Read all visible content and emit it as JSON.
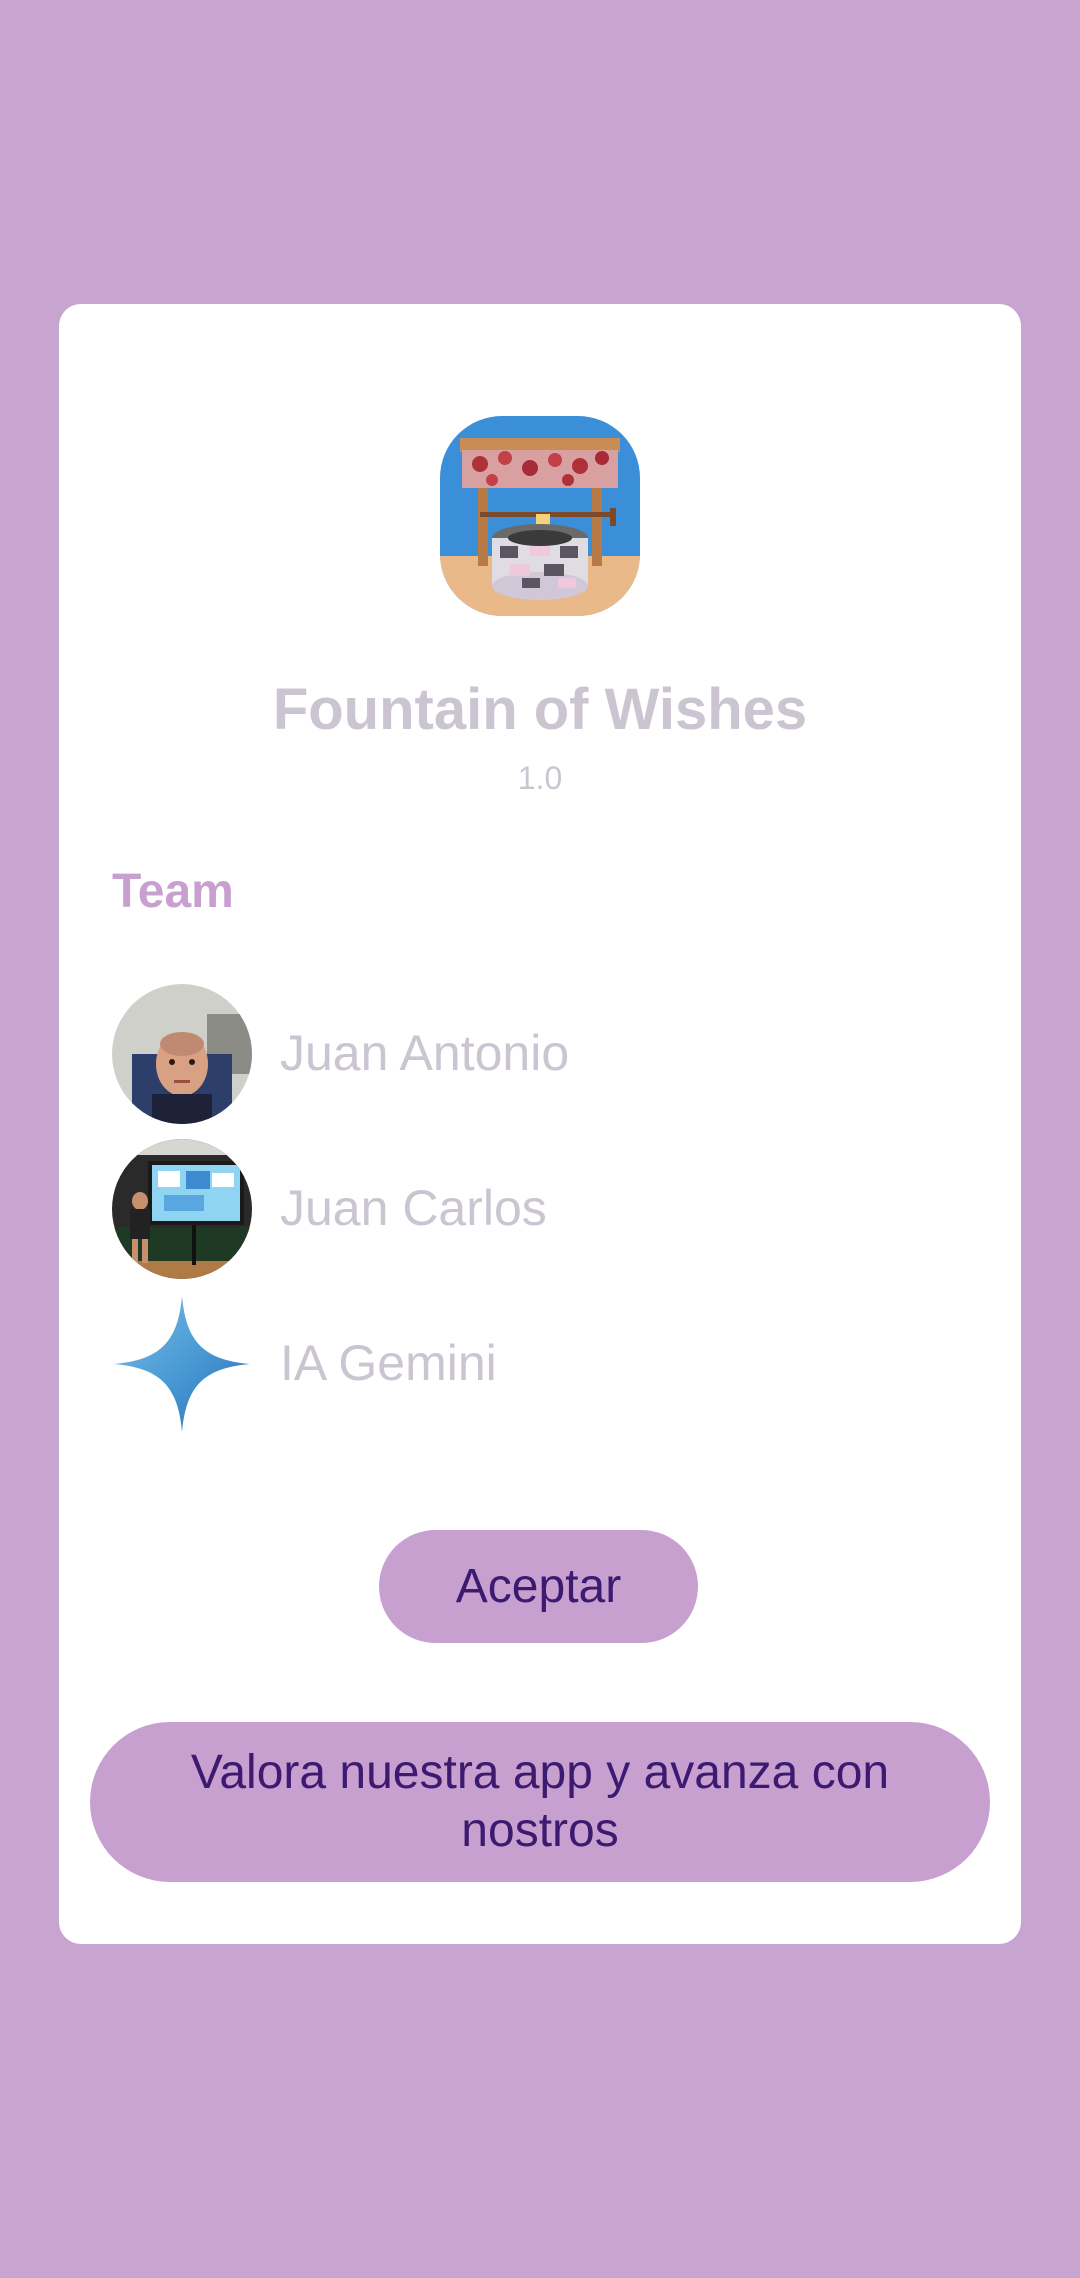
{
  "dialog": {
    "app_icon": "fountain-well-icon",
    "title": "Fountain of Wishes",
    "version": "1.0",
    "team_heading": "Team",
    "members": [
      {
        "name": "Juan Antonio",
        "avatar": "photo-avatar"
      },
      {
        "name": "Juan Carlos",
        "avatar": "photo-avatar"
      },
      {
        "name": "IA Gemini",
        "avatar": "gemini-sparkle-icon"
      }
    ],
    "accept_label": "Aceptar",
    "rate_label": "Valora nuestra app y avanza con nostros"
  },
  "colors": {
    "background": "#c8a4d0",
    "dialog": "#ffffff",
    "accent": "#c8a0d0",
    "button_text": "#3b1a70",
    "muted_text": "#cbc5d2"
  }
}
